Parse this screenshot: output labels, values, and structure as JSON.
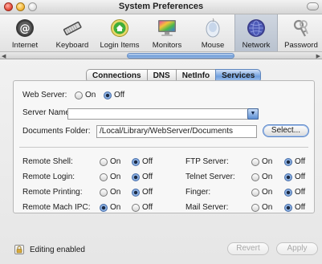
{
  "window": {
    "title": "System Preferences"
  },
  "toolbar": {
    "items": [
      {
        "label": "Internet",
        "icon": "internet-icon"
      },
      {
        "label": "Keyboard",
        "icon": "keyboard-icon"
      },
      {
        "label": "Login Items",
        "icon": "login-items-icon"
      },
      {
        "label": "Monitors",
        "icon": "monitors-icon"
      },
      {
        "label": "Mouse",
        "icon": "mouse-icon"
      },
      {
        "label": "Network",
        "icon": "network-icon",
        "selected": true
      },
      {
        "label": "Password",
        "icon": "password-icon"
      }
    ]
  },
  "tabs": [
    {
      "label": "Connections"
    },
    {
      "label": "DNS"
    },
    {
      "label": "NetInfo"
    },
    {
      "label": "Services",
      "selected": true
    }
  ],
  "web_server": {
    "label": "Web Server:",
    "on_label": "On",
    "off_label": "Off",
    "value": "Off"
  },
  "server_name": {
    "label": "Server Name:",
    "value": ""
  },
  "documents_folder": {
    "label": "Documents Folder:",
    "value": "/Local/Library/WebServer/Documents",
    "button": "Select..."
  },
  "services_left": [
    {
      "label": "Remote Shell:",
      "value": "Off"
    },
    {
      "label": "Remote Login:",
      "value": "Off"
    },
    {
      "label": "Remote Printing:",
      "value": "Off"
    },
    {
      "label": "Remote Mach IPC:",
      "value": "On"
    }
  ],
  "services_right": [
    {
      "label": "FTP Server:",
      "value": "Off"
    },
    {
      "label": "Telnet Server:",
      "value": "Off"
    },
    {
      "label": "Finger:",
      "value": "Off"
    },
    {
      "label": "Mail Server:",
      "value": "Off"
    }
  ],
  "radio_labels": {
    "on": "On",
    "off": "Off"
  },
  "footer": {
    "lock_text": "Editing enabled",
    "revert": "Revert",
    "apply": "Apply"
  },
  "colors": {
    "accent": "#6f9fdd",
    "selected_toolbar": "#c3cbd6"
  }
}
